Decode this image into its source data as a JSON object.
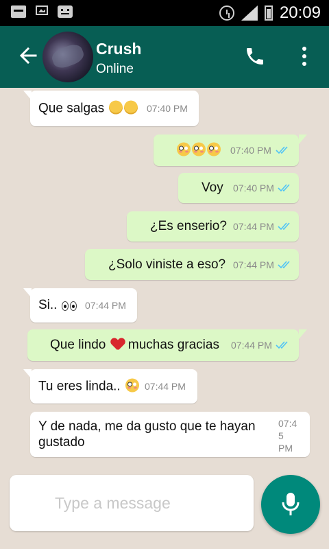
{
  "status_bar": {
    "time": "20:09",
    "icons": [
      "message-notification-icon",
      "image-notification-icon",
      "bbm-icon",
      "alarm-icon",
      "signal-icon",
      "battery-icon"
    ]
  },
  "header": {
    "contact_name": "Crush",
    "contact_status": "Online",
    "icons": [
      "back-arrow-icon",
      "avatar",
      "phone-icon",
      "more-vert-icon"
    ]
  },
  "messages": [
    {
      "direction": "in",
      "text": "Que salgas",
      "emoji": [
        "smile",
        "smile"
      ],
      "time": "07:40 PM"
    },
    {
      "direction": "out",
      "text": "",
      "emoji": [
        "flushed",
        "flushed",
        "flushed"
      ],
      "time": "07:40 PM",
      "read": true
    },
    {
      "direction": "out",
      "text": "Voy",
      "time": "07:40 PM",
      "read": true
    },
    {
      "direction": "out",
      "text": "¿Es enserio?",
      "time": "07:44 PM",
      "read": true
    },
    {
      "direction": "out",
      "text": "¿Solo viniste a eso?",
      "time": "07:44 PM",
      "read": true
    },
    {
      "direction": "in",
      "text": "Si..",
      "emoji": [
        "eyes"
      ],
      "time": "07:44 PM"
    },
    {
      "direction": "out",
      "text_before": "Que lindo",
      "emoji": [
        "heart"
      ],
      "text_after": "muchas gracias",
      "time": "07:44 PM",
      "read": true
    },
    {
      "direction": "in",
      "text": "Tu eres linda..",
      "emoji": [
        "flushed"
      ],
      "time": "07:44 PM"
    },
    {
      "direction": "in",
      "text_line1": "Y de nada, me da gusto que te hayan",
      "text_line2": "gustado",
      "time_line1": "07:4",
      "time_line2": "5",
      "time_line3": "PM"
    }
  ],
  "composer": {
    "placeholder": "Type a message"
  },
  "colors": {
    "header": "#075e54",
    "outgoing_bubble": "#dcf8c6",
    "incoming_bubble": "#ffffff",
    "read_ticks": "#4fc3f7",
    "mic_button": "#00897b"
  }
}
